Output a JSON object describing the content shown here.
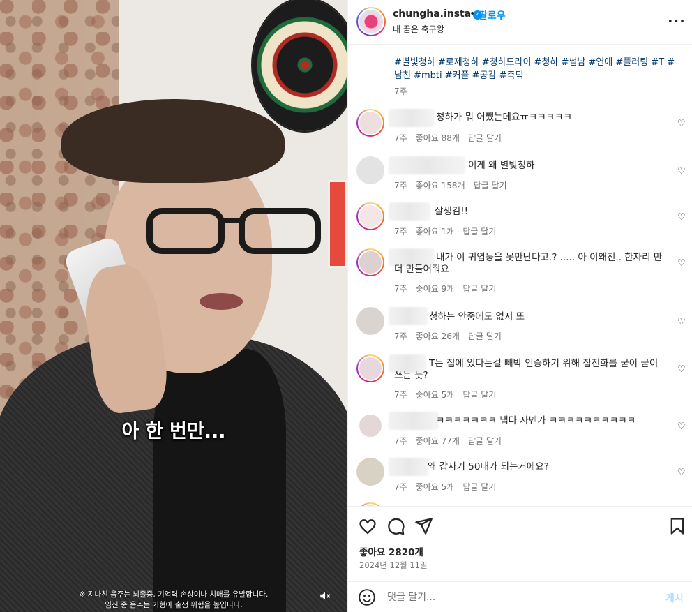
{
  "media": {
    "subtitle": "아 한 번만...",
    "warning_line1": "※ 지나친 음주는 뇌졸중, 기억력 손상이나 치매를 유발합니다.",
    "warning_line2": "임신 중 음주는 기형아 출생 위험을 높입니다.",
    "mute_icon": "speaker-muted-icon"
  },
  "header": {
    "username": "chungha.insta",
    "verified_icon": "verified-badge-icon",
    "separator": "•",
    "follow_label": "팔로우",
    "subtitle": "내 꿈은 축구왕",
    "more_icon": "more-options-icon",
    "more_label": "···"
  },
  "caption": {
    "hashtags": "#별빛청하 #로제청하 #청하드라이 #청하 #썸남 #연애 #플러팅 #T #남친 #mbti #커플 #공감 #축덕",
    "time": "7주"
  },
  "comments": [
    {
      "text": "청하가 뭐 어쨌는데요ㅠㅋㅋㅋㅋㅋ",
      "time": "7주",
      "likes": "좋아요 88개",
      "reply": "답글 달기"
    },
    {
      "text": "이게 왜 별빛청하",
      "time": "7주",
      "likes": "좋아요 158개",
      "reply": "답글 달기"
    },
    {
      "text": "잘생김!!",
      "time": "7주",
      "likes": "좋아요 1개",
      "reply": "답글 달기"
    },
    {
      "text": "내가 이 귀염둥을 못만난다고.? ..... 아 이왜진.. 한자리 만 더 만들어줘요",
      "time": "7주",
      "likes": "좋아요 9개",
      "reply": "답글 달기"
    },
    {
      "text": "청하는 안중에도 없지 또",
      "time": "7주",
      "likes": "좋아요 26개",
      "reply": "답글 달기"
    },
    {
      "text": "T는 집에 있다는걸 빼박 인증하기 위해 집전화를 굳이 굳이 쓰는 듯?",
      "time": "7주",
      "likes": "좋아요 5개",
      "reply": "답글 달기"
    },
    {
      "text": "ㅋㅋㅋㅋㅋㅋㅋ 냅다 자넨가 ㅋㅋㅋㅋㅋㅋㅋㅋㅋㅋ",
      "time": "7주",
      "likes": "좋아요 77개",
      "reply": "답글 달기"
    },
    {
      "text": "왜 갑자기 50대가 되는거에요?",
      "time": "7주",
      "likes": "좋아요 5개",
      "reply": "답글 달기"
    }
  ],
  "actions": {
    "like_icon": "heart-icon",
    "comment_icon": "comment-icon",
    "share_icon": "send-icon",
    "save_icon": "bookmark-icon",
    "likes": "좋아요 2820개",
    "date": "2024년 12월 11일"
  },
  "composer": {
    "emoji_icon": "emoji-icon",
    "placeholder": "댓글 달기...",
    "post_label": "게시"
  }
}
